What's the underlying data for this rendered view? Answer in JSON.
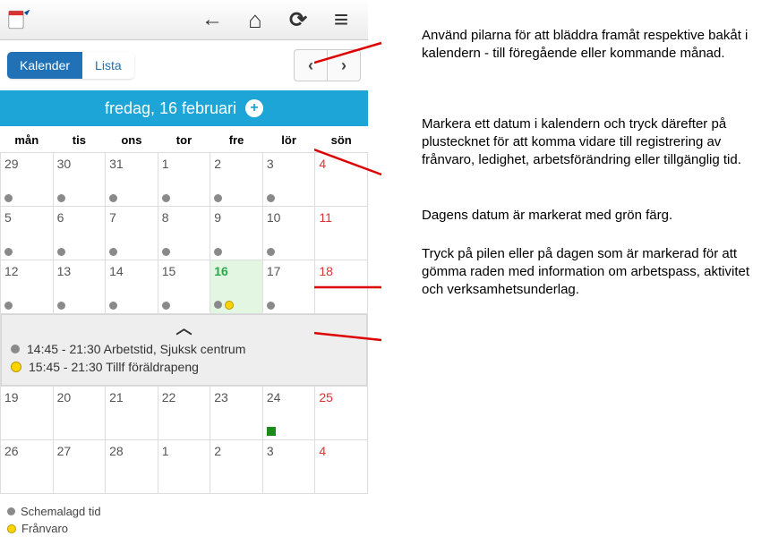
{
  "toolbar": {
    "back": "←",
    "home": "⌂",
    "refresh": "⟳",
    "menu": "≡"
  },
  "tabs": {
    "calendar": "Kalender",
    "list": "Lista"
  },
  "nav": {
    "prev": "‹",
    "next": "›"
  },
  "selectedDay": {
    "label": "fredag, 16 februari"
  },
  "weekdays": [
    "mån",
    "tis",
    "ons",
    "tor",
    "fre",
    "lör",
    "sön"
  ],
  "grid": [
    [
      {
        "n": "29",
        "o": true,
        "d": 1
      },
      {
        "n": "30",
        "o": true,
        "d": 1
      },
      {
        "n": "31",
        "o": true,
        "d": 1
      },
      {
        "n": "1",
        "d": 1
      },
      {
        "n": "2",
        "d": 1
      },
      {
        "n": "3",
        "d": 1
      },
      {
        "n": "4",
        "sun": true
      }
    ],
    [
      {
        "n": "5",
        "d": 1
      },
      {
        "n": "6",
        "d": 1
      },
      {
        "n": "7",
        "d": 1
      },
      {
        "n": "8",
        "d": 1
      },
      {
        "n": "9",
        "d": 1
      },
      {
        "n": "10",
        "d": 1
      },
      {
        "n": "11",
        "sun": true
      }
    ],
    [
      {
        "n": "12",
        "d": 1
      },
      {
        "n": "13",
        "d": 1
      },
      {
        "n": "14",
        "d": 1
      },
      {
        "n": "15",
        "d": 1
      },
      {
        "n": "16",
        "today": true,
        "d": 1,
        "y": 1
      },
      {
        "n": "17",
        "d": 1
      },
      {
        "n": "18",
        "sun": true
      }
    ],
    [
      {
        "n": "19"
      },
      {
        "n": "20"
      },
      {
        "n": "21"
      },
      {
        "n": "22"
      },
      {
        "n": "23"
      },
      {
        "n": "24",
        "sq": 1
      },
      {
        "n": "25",
        "sun": true
      }
    ],
    [
      {
        "n": "26"
      },
      {
        "n": "27"
      },
      {
        "n": "28"
      },
      {
        "n": "1",
        "o": true
      },
      {
        "n": "2",
        "o": true
      },
      {
        "n": "3",
        "o": true
      },
      {
        "n": "4",
        "o": true,
        "sun": true
      }
    ]
  ],
  "detail": {
    "line1": "14:45 - 21:30 Arbetstid, Sjuksk centrum",
    "line2": "15:45 - 21:30 Tillf föräldrapeng"
  },
  "legend": {
    "schemalagd": "Schemalagd tid",
    "franvaro": "Frånvaro"
  },
  "notes": {
    "n1": "Använd pilarna för att bläddra framåt respektive bakåt i kalendern - till föregående eller kommande månad.",
    "n2": "Markera ett datum i kalendern och tryck därefter på plustecknet för att komma vidare till registrering av frånvaro, ledighet, arbetsförändring eller tillgänglig tid.",
    "n3": "Dagens datum är markerat med grön färg.",
    "n4": "Tryck på pilen eller på dagen som är markerad för att gömma raden med information om arbetspass, aktivitet och verksamhetsunderlag."
  }
}
